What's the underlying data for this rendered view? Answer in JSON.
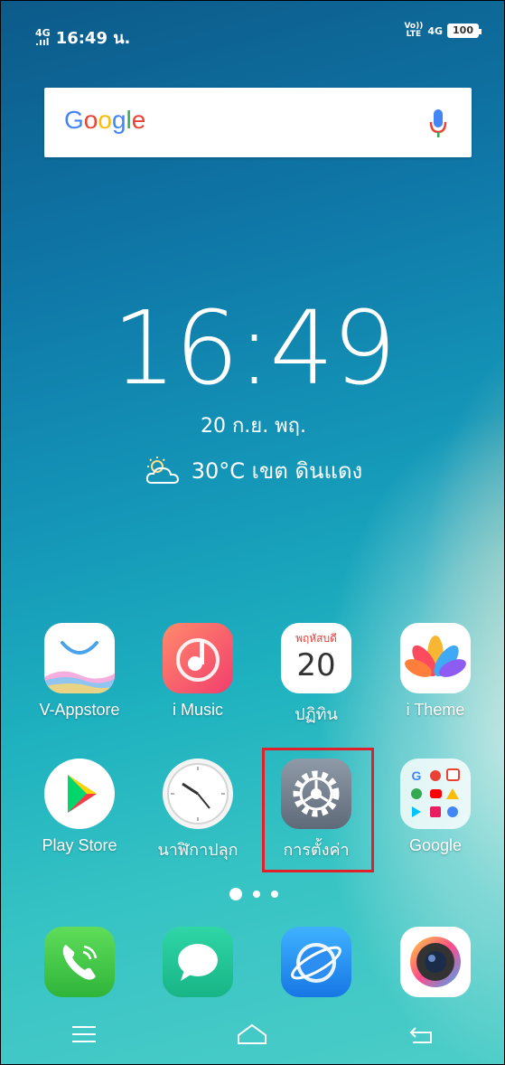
{
  "status_bar": {
    "network_left": "4G",
    "time": "16:49 น.",
    "volte": "Vo))\nLTE",
    "network_right": "4G",
    "battery": "100"
  },
  "search": {
    "logo_letters": [
      "G",
      "o",
      "o",
      "g",
      "l",
      "e"
    ]
  },
  "clock": {
    "time": "16:49"
  },
  "date": {
    "text": "20 ก.ย.  พฤ."
  },
  "weather": {
    "text": "30°C เขต ดินแดง"
  },
  "apps_row1": [
    {
      "label": "V-Appstore"
    },
    {
      "label": "i Music"
    },
    {
      "label": "ปฏิทิน",
      "calendar_day_name": "พฤหัสบดี",
      "calendar_day": "20"
    },
    {
      "label": "i Theme"
    }
  ],
  "apps_row2": [
    {
      "label": "Play Store"
    },
    {
      "label": "นาฬิกาปลุก"
    },
    {
      "label": "การตั้งค่า"
    },
    {
      "label": "Google"
    }
  ],
  "colors": {
    "highlight": "#e0202a"
  }
}
